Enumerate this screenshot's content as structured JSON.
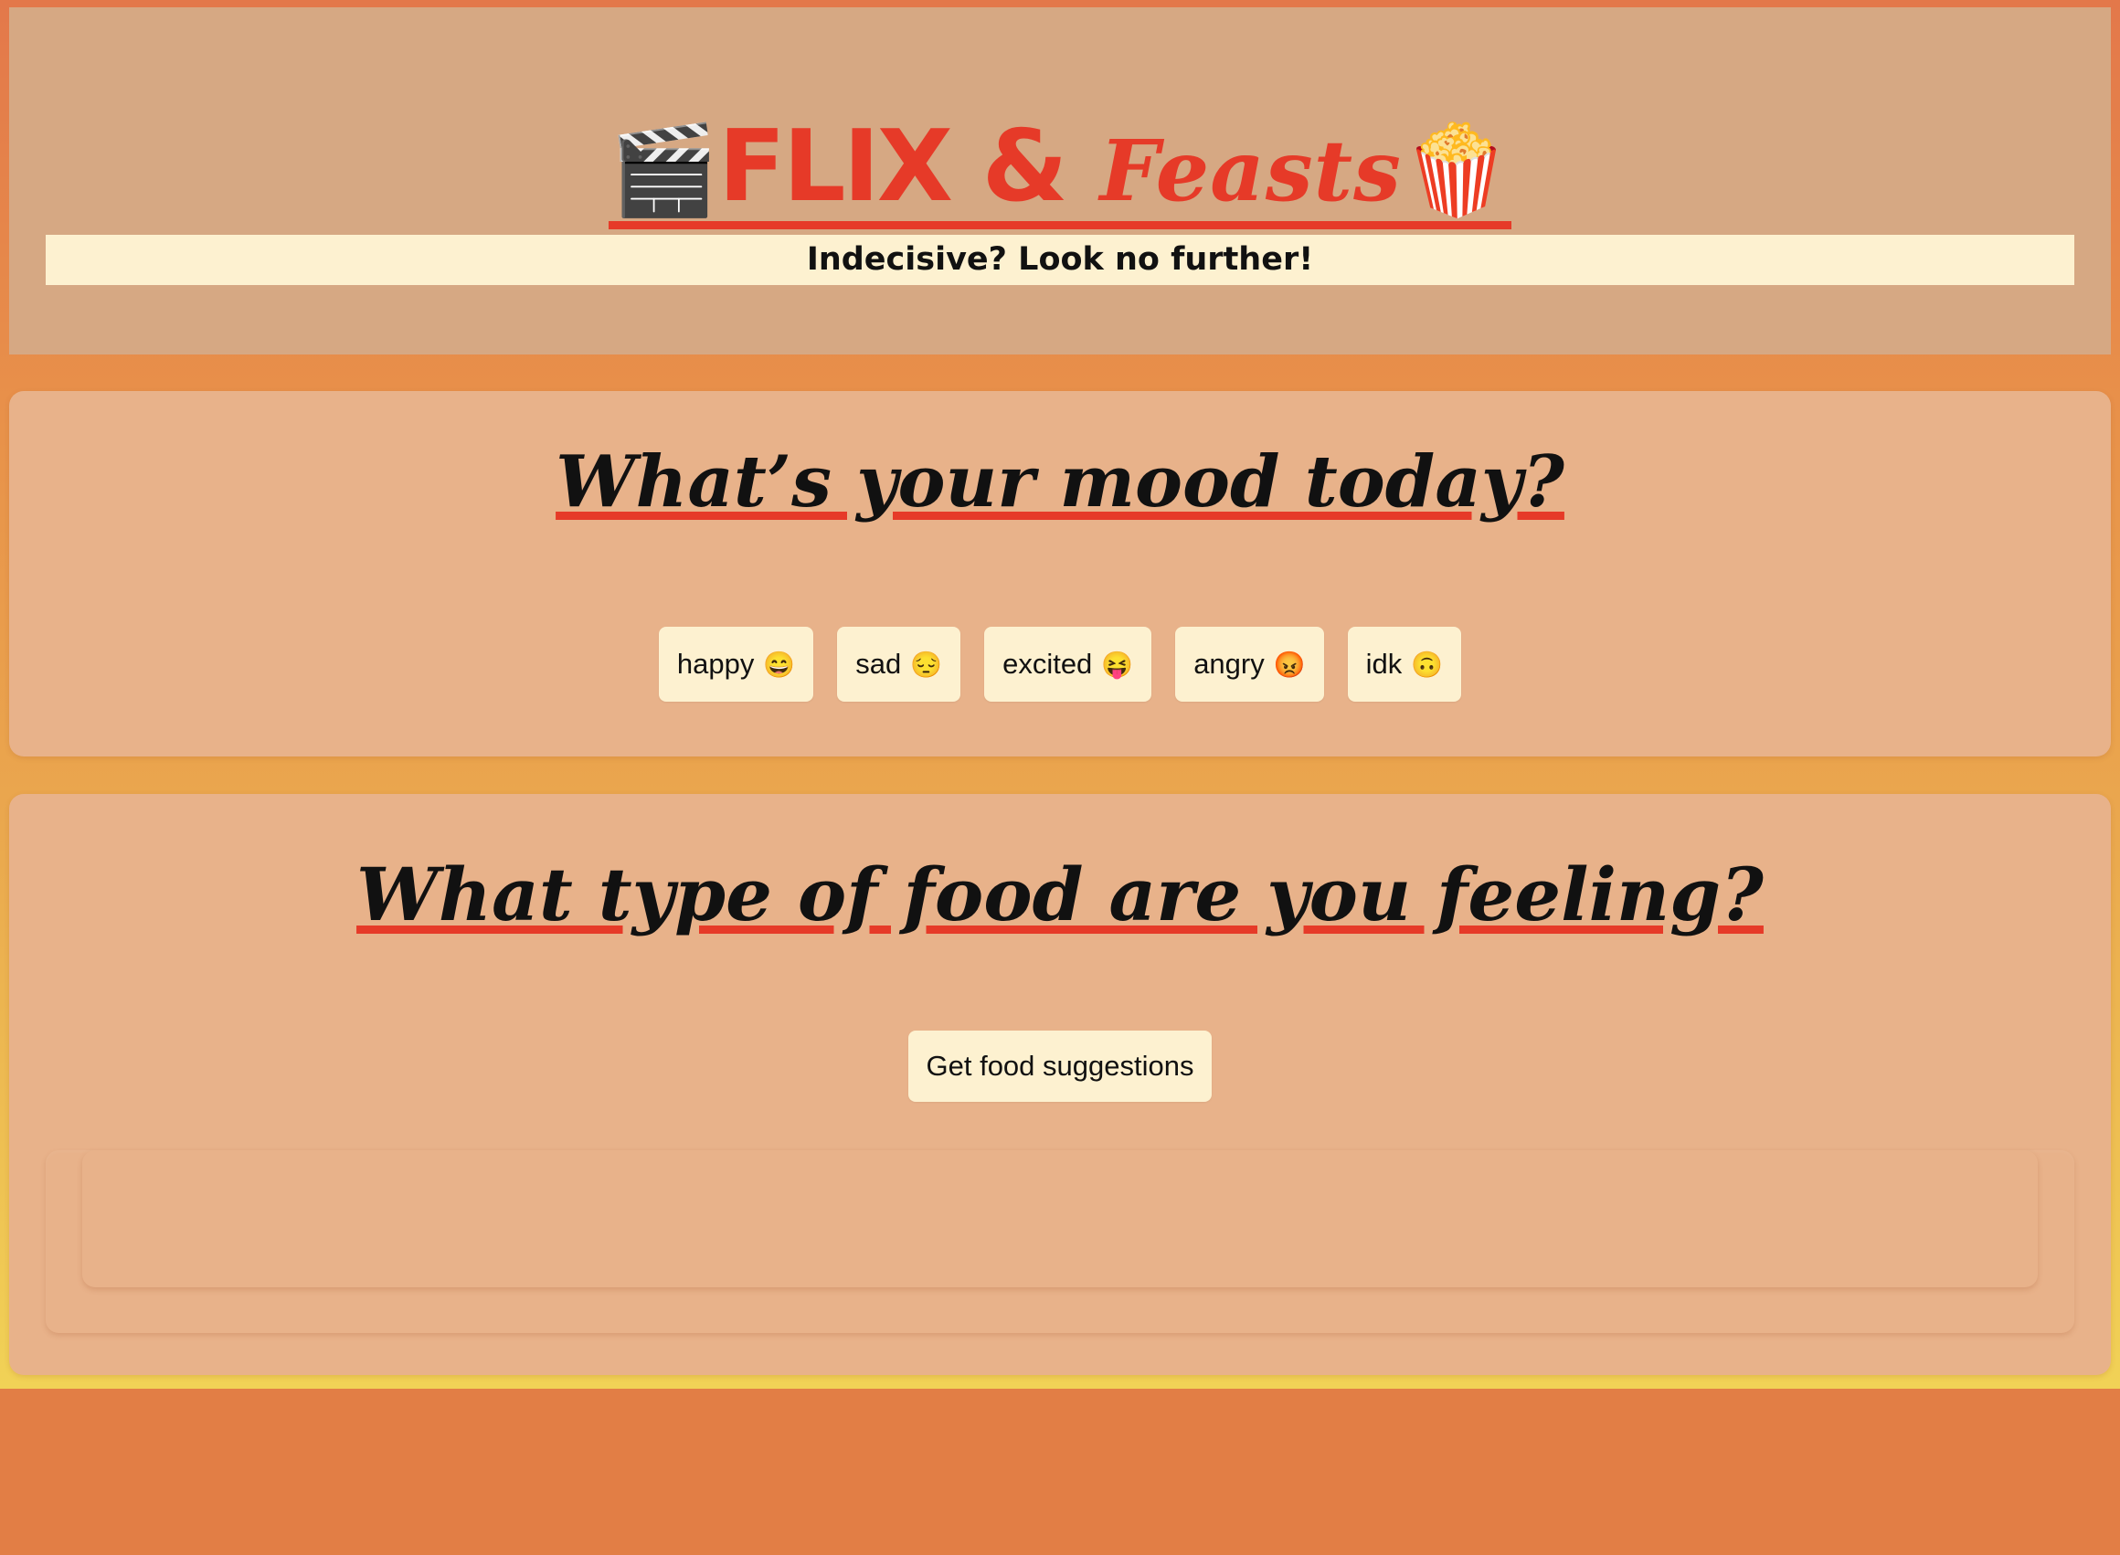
{
  "header": {
    "title_emoji_left": "🎬",
    "title_flix": "FLIX &",
    "title_feasts": "Feasts",
    "title_emoji_right": "🍿",
    "tagline": "Indecisive? Look no further!"
  },
  "mood_section": {
    "heading": "What’s your mood today?",
    "buttons": [
      {
        "label": "happy",
        "emoji": "😄"
      },
      {
        "label": "sad",
        "emoji": "😔"
      },
      {
        "label": "excited",
        "emoji": "😝"
      },
      {
        "label": "angry",
        "emoji": "😡"
      },
      {
        "label": "idk",
        "emoji": "🙃"
      }
    ]
  },
  "food_section": {
    "heading": "What type of food are you feeling?",
    "button_label": "Get food suggestions"
  },
  "colors": {
    "accent": "#e63a28",
    "header_bg": "#d6a883",
    "card_bg": "#e8b28a",
    "button_bg": "#fdf1d0",
    "page_bottom": "#e27e45"
  }
}
